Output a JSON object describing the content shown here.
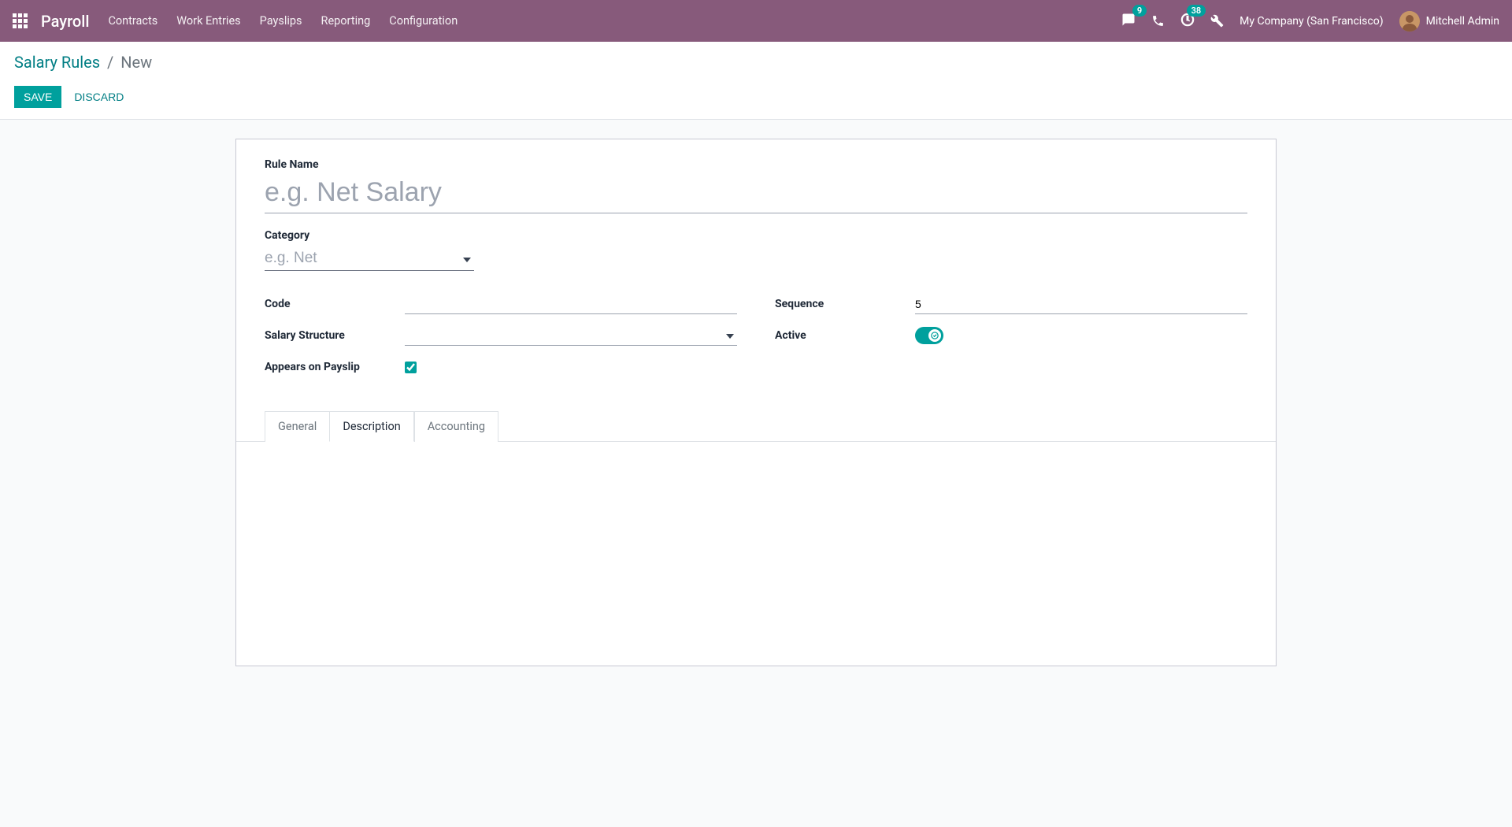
{
  "navbar": {
    "brand": "Payroll",
    "menu": [
      "Contracts",
      "Work Entries",
      "Payslips",
      "Reporting",
      "Configuration"
    ],
    "messages_count": "9",
    "activities_count": "38",
    "company": "My Company (San Francisco)",
    "user": "Mitchell Admin"
  },
  "breadcrumb": {
    "parent": "Salary Rules",
    "separator": "/",
    "current": "New"
  },
  "actions": {
    "save": "SAVE",
    "discard": "DISCARD"
  },
  "form": {
    "rule_name_label": "Rule Name",
    "rule_name_placeholder": "e.g. Net Salary",
    "rule_name_value": "",
    "category_label": "Category",
    "category_placeholder": "e.g. Net",
    "category_value": "",
    "code_label": "Code",
    "code_value": "",
    "salary_structure_label": "Salary Structure",
    "salary_structure_value": "",
    "appears_on_payslip_label": "Appears on Payslip",
    "appears_on_payslip_value": true,
    "sequence_label": "Sequence",
    "sequence_value": "5",
    "active_label": "Active",
    "active_value": true
  },
  "tabs": {
    "items": [
      "General",
      "Description",
      "Accounting"
    ],
    "active_index": 1
  }
}
